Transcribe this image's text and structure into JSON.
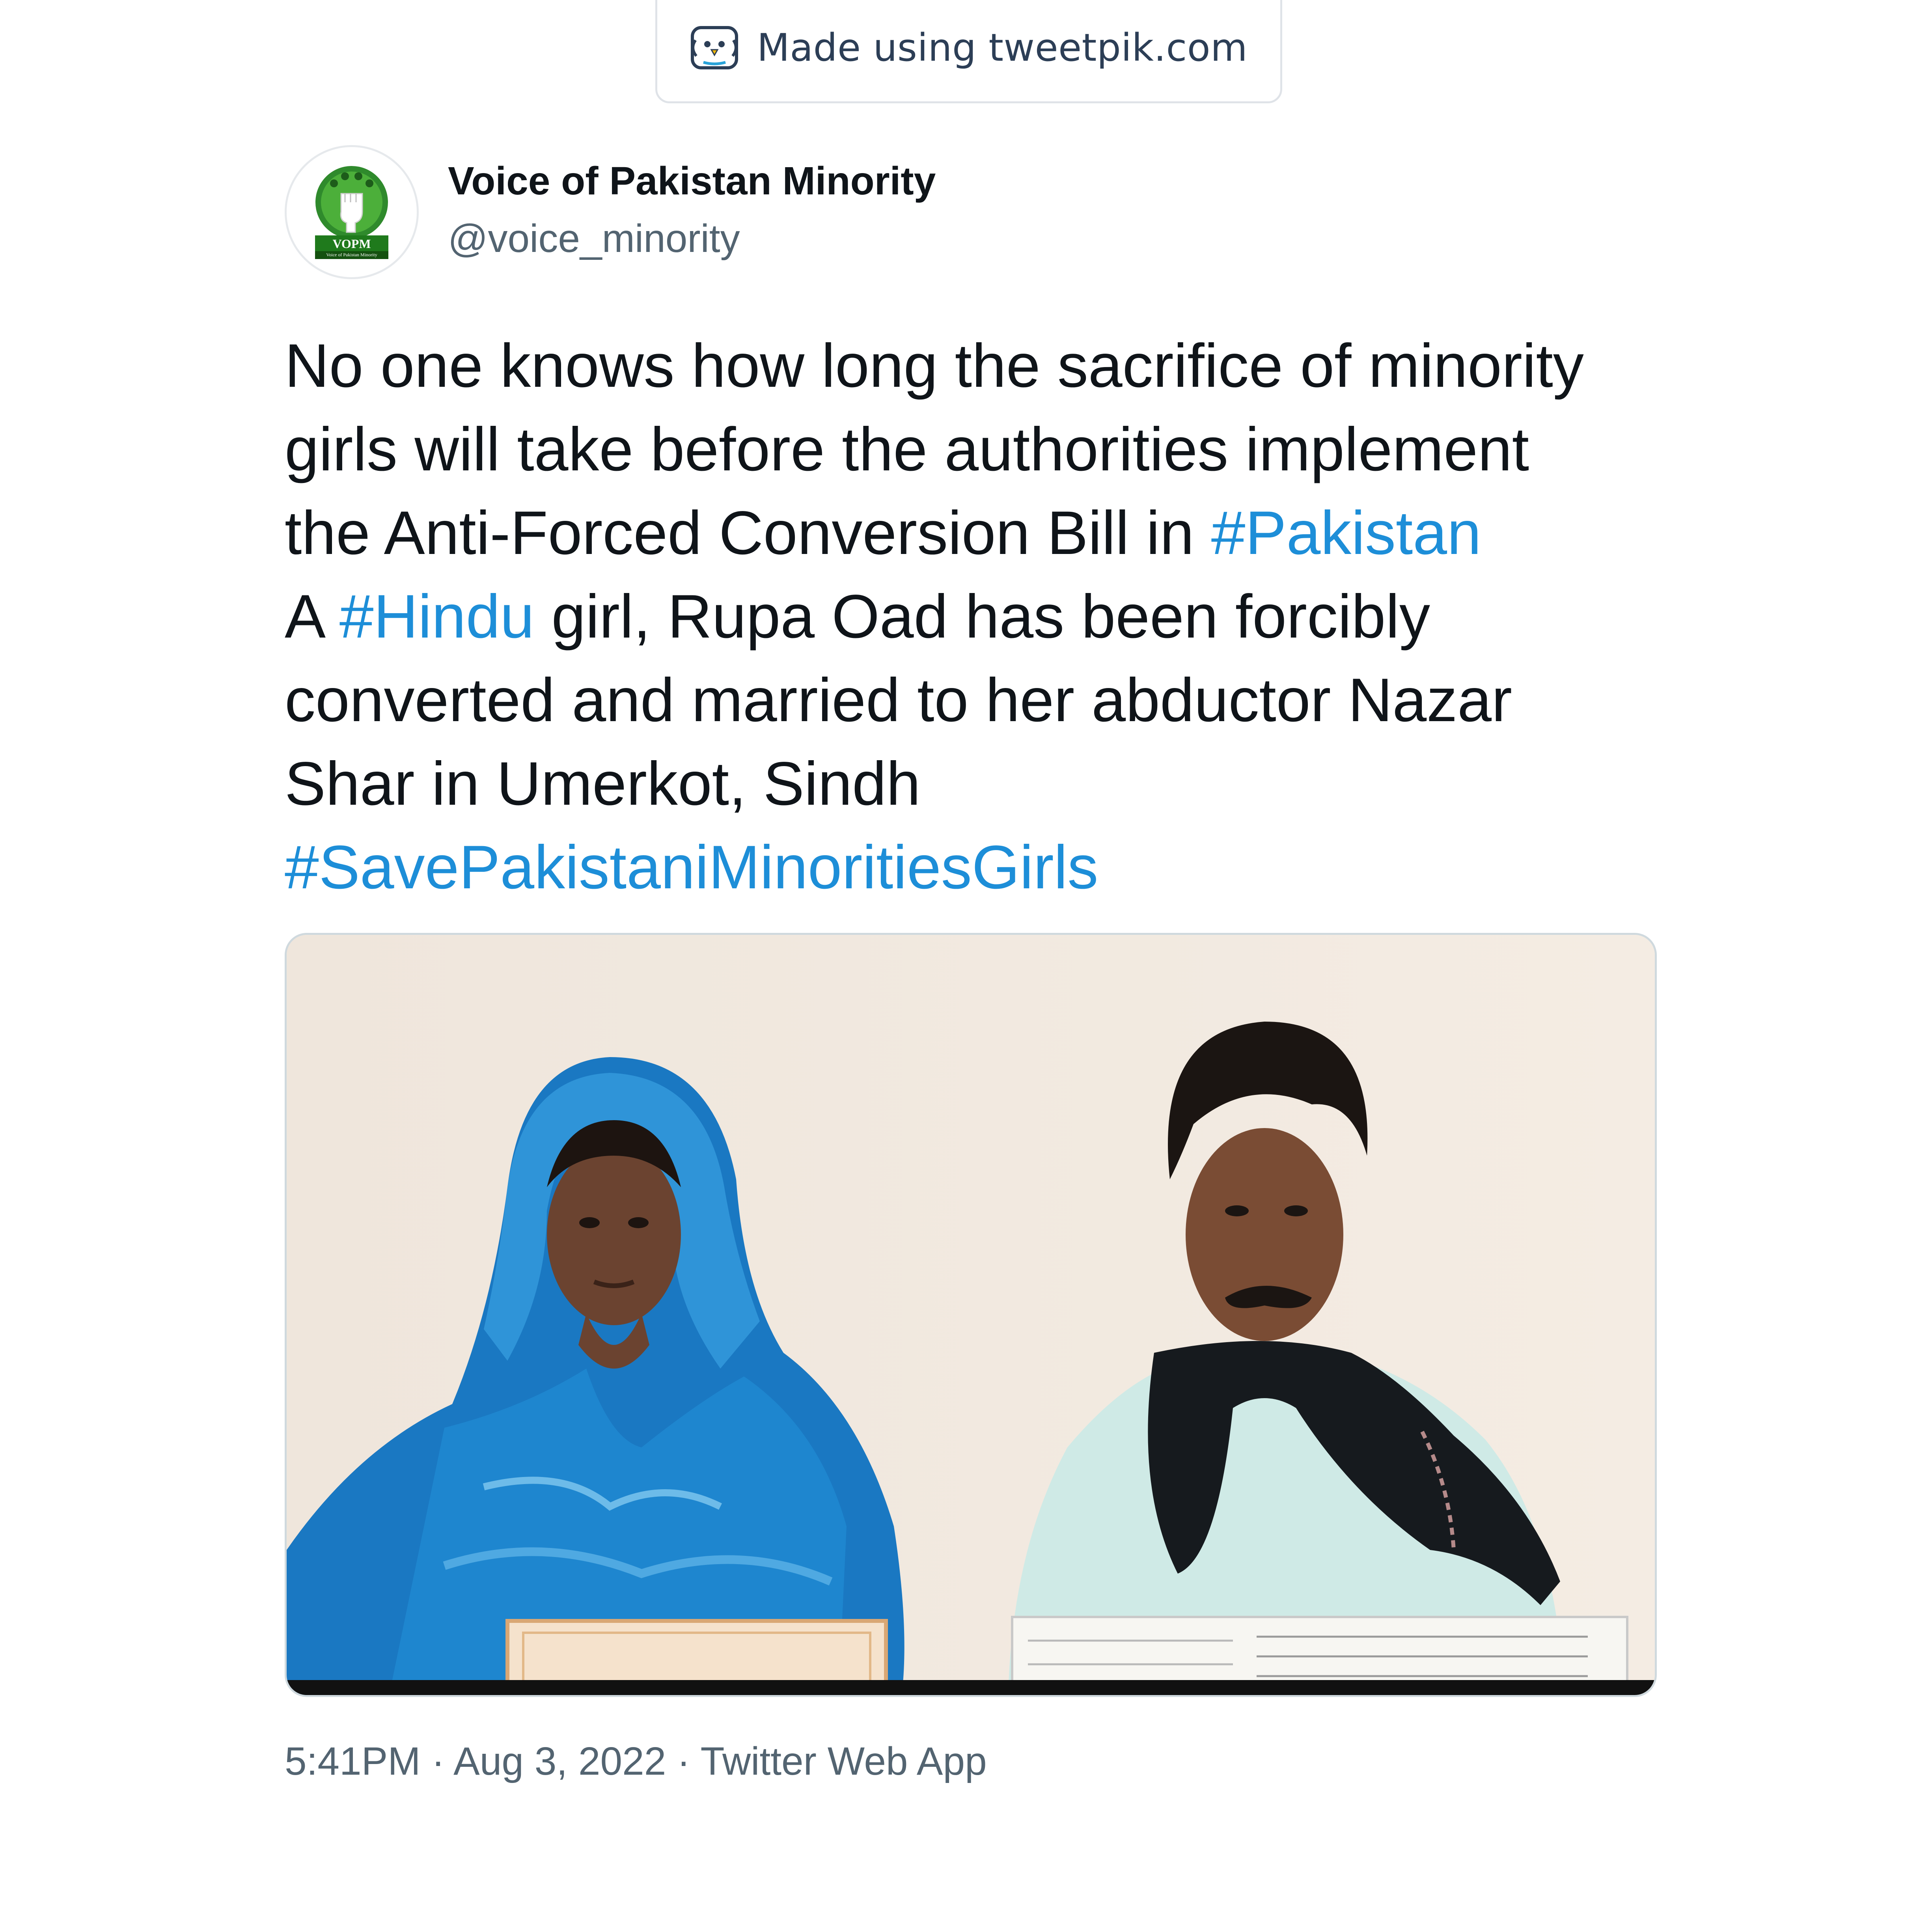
{
  "watermark": {
    "icon": "tweetpik-bird-icon",
    "text": "Made using tweetpik.com"
  },
  "author": {
    "avatar": "vopm-logo",
    "avatar_text": "VOPM",
    "avatar_subtext": "Voice of Pakistan Minority",
    "display_name": "Voice of Pakistan Minority",
    "handle": "@voice_minority"
  },
  "tweet": {
    "line1": "No one knows how long the sacrifice of minority",
    "line2": "girls will take before the authorities implement",
    "line3_text": "the Anti-Forced Conversion Bill in ",
    "line3_tag": "#Pakistan",
    "line4_pre": "A ",
    "line4_tag": "#Hindu",
    "line4_post": " girl, Rupa Oad has been forcibly",
    "line5": "converted and married to her abductor Nazar",
    "line6": "Shar in Umerkot, Sindh",
    "line7_tag": "#SavePakistaniMinoritiesGirls"
  },
  "media": {
    "description_icon": "photo"
  },
  "footer": {
    "time": "5:41PM",
    "separator": "·",
    "date": "Aug 3, 2022",
    "source": "Twitter Web App"
  },
  "colors": {
    "hashtag": "#1d8ed8",
    "text": "#0f1419",
    "muted": "#536471"
  }
}
